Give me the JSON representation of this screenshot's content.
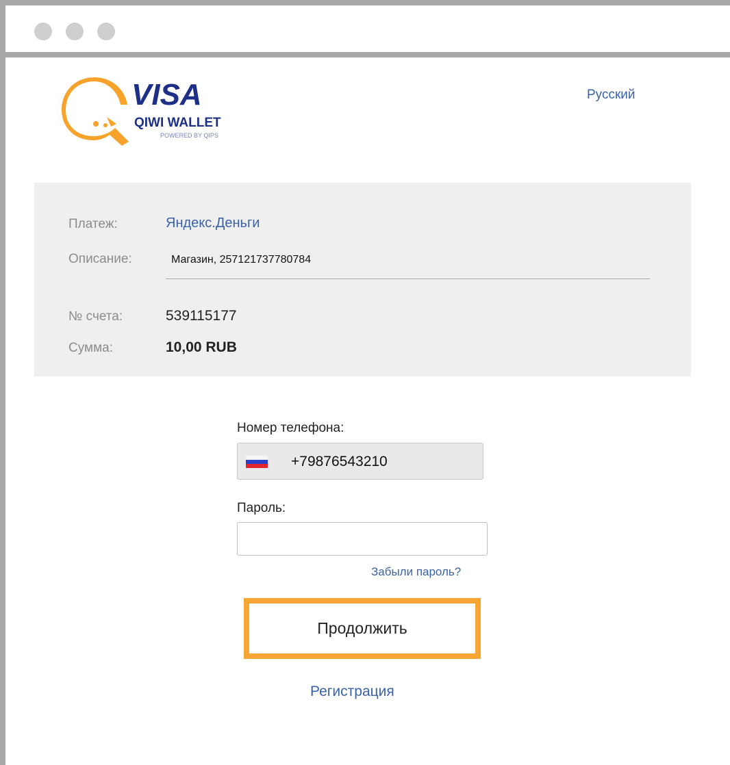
{
  "window": {
    "controls": [
      "window-control-1",
      "window-control-2",
      "window-control-3"
    ]
  },
  "header": {
    "logo": {
      "brand_visa": "VISA",
      "brand_name": "QIWI WALLET",
      "powered_by": "POWERED BY QIPS",
      "colors": {
        "orange": "#f7a22b",
        "navy": "#1d2f86"
      }
    },
    "language": "Русский"
  },
  "payment_info": {
    "payment_label": "Платеж:",
    "payment_value": "Яндекс.Деньги",
    "description_label": "Описание:",
    "description_value": "Магазин, 257121737780784",
    "account_label": "№ счета:",
    "account_value": "539115177",
    "amount_label": "Сумма:",
    "amount_value": "10,00 RUB"
  },
  "login_form": {
    "phone_label": "Номер телефона:",
    "phone_value": "+79876543210",
    "phone_flag_icon": "russia-flag-icon",
    "password_label": "Пароль:",
    "password_value": "",
    "forgot_link": "Забыли пароль?",
    "continue_button": "Продолжить",
    "register_link": "Регистрация"
  },
  "colors": {
    "link": "#3a62a8",
    "highlight_border": "#f7a535",
    "panel_bg": "#efefef",
    "frame": "#a8a8a8"
  }
}
